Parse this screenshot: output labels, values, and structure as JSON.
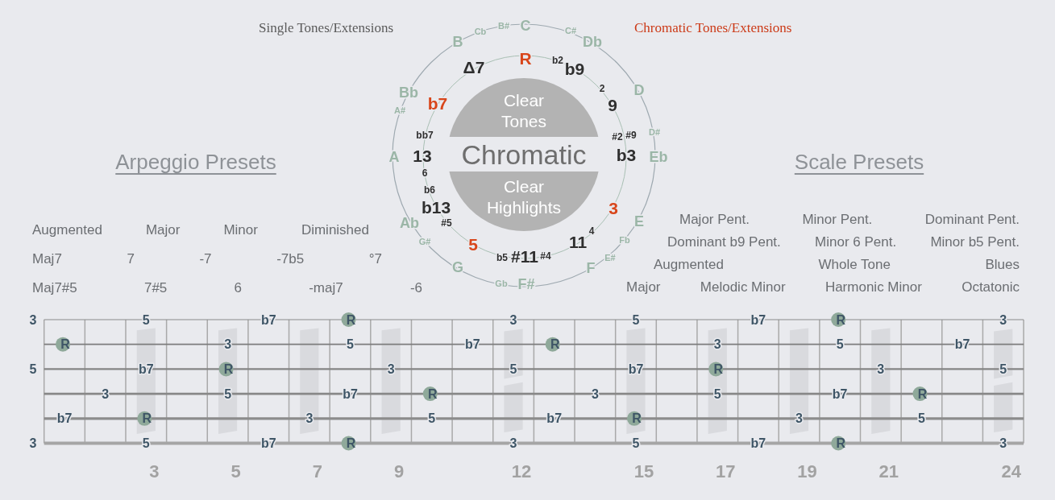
{
  "mode_toggle": [
    {
      "label": "Single Tones/Extensions",
      "selected": false
    },
    {
      "label": "Chromatic Tones/Extensions",
      "selected": true
    }
  ],
  "circle": {
    "notes": [
      {
        "label": "Cb",
        "kind": "secondary"
      },
      {
        "label": "B#",
        "kind": "secondary"
      },
      {
        "label": "C",
        "kind": "primary"
      },
      {
        "label": "C#",
        "kind": "secondary"
      },
      {
        "label": "B",
        "kind": "primary"
      },
      {
        "label": "Db",
        "kind": "primary"
      },
      {
        "label": "Bb",
        "kind": "primary"
      },
      {
        "label": "D",
        "kind": "primary"
      },
      {
        "label": "A#",
        "kind": "secondary"
      },
      {
        "label": "D#",
        "kind": "secondary"
      },
      {
        "label": "A",
        "kind": "primary"
      },
      {
        "label": "Eb",
        "kind": "primary"
      },
      {
        "label": "Ab",
        "kind": "primary"
      },
      {
        "label": "E",
        "kind": "primary"
      },
      {
        "label": "G#",
        "kind": "secondary"
      },
      {
        "label": "Fb",
        "kind": "secondary"
      },
      {
        "label": "E#",
        "kind": "secondary"
      },
      {
        "label": "G",
        "kind": "primary"
      },
      {
        "label": "F",
        "kind": "primary"
      },
      {
        "label": "Gb",
        "kind": "secondary"
      },
      {
        "label": "F#",
        "kind": "primary"
      }
    ],
    "intervals": [
      {
        "label": "Δ7",
        "kind": "primary",
        "selected": false
      },
      {
        "label": "R",
        "kind": "primary",
        "selected": true
      },
      {
        "label": "b2",
        "kind": "secondary",
        "selected": false
      },
      {
        "label": "b9",
        "kind": "primary",
        "selected": false
      },
      {
        "label": "2",
        "kind": "secondary",
        "selected": false
      },
      {
        "label": "b7",
        "kind": "primary",
        "selected": true
      },
      {
        "label": "9",
        "kind": "primary",
        "selected": false
      },
      {
        "label": "bb7",
        "kind": "secondary",
        "selected": false
      },
      {
        "label": "#2",
        "kind": "secondary",
        "selected": false
      },
      {
        "label": "#9",
        "kind": "secondary",
        "selected": false
      },
      {
        "label": "13",
        "kind": "primary",
        "selected": false
      },
      {
        "label": "b3",
        "kind": "primary",
        "selected": false
      },
      {
        "label": "6",
        "kind": "secondary",
        "selected": false
      },
      {
        "label": "b6",
        "kind": "secondary",
        "selected": false
      },
      {
        "label": "b13",
        "kind": "primary",
        "selected": false
      },
      {
        "label": "3",
        "kind": "primary",
        "selected": true
      },
      {
        "label": "#5",
        "kind": "secondary",
        "selected": false
      },
      {
        "label": "5",
        "kind": "primary",
        "selected": true
      },
      {
        "label": "11",
        "kind": "primary",
        "selected": false
      },
      {
        "label": "4",
        "kind": "secondary",
        "selected": false
      },
      {
        "label": "b5",
        "kind": "secondary",
        "selected": false
      },
      {
        "label": "#11",
        "kind": "primary",
        "selected": false
      },
      {
        "label": "#4",
        "kind": "secondary",
        "selected": false
      }
    ],
    "clear_tones_button": "Clear Tones",
    "mode_label": "Chromatic",
    "clear_highlights_button": "Clear Highlights"
  },
  "arpeggio_presets": {
    "title": "Arpeggio Presets",
    "options": [
      "Augmented",
      "Major",
      "Minor",
      "Diminished",
      "Maj7",
      "7",
      "-7",
      "-7b5",
      "°7",
      "Maj7#5",
      "7#5",
      "6",
      "-maj7",
      "-6"
    ]
  },
  "scale_presets": {
    "title": "Scale Presets",
    "options": [
      "Major Pent.",
      "Minor Pent.",
      "Dominant Pent.",
      "Dominant b9 Pent.",
      "Minor 6 Pent.",
      "Minor b5 Pent.",
      "Augmented",
      "Whole Tone",
      "Blues",
      "Major",
      "Melodic Minor",
      "Harmonic Minor",
      "Octatonic"
    ]
  },
  "fretboard": {
    "strings": [
      {
        "notes": [
          {
            "label": "3",
            "root": false
          },
          {
            "label": "5",
            "root": false
          },
          {
            "label": "b7",
            "root": false
          },
          {
            "label": "R",
            "root": true
          },
          {
            "label": "3",
            "root": false
          },
          {
            "label": "5",
            "root": false
          },
          {
            "label": "b7",
            "root": false
          },
          {
            "label": "R",
            "root": true
          },
          {
            "label": "3",
            "root": false
          }
        ]
      },
      {
        "notes": [
          {
            "label": "R",
            "root": true
          },
          {
            "label": "3",
            "root": false
          },
          {
            "label": "5",
            "root": false
          },
          {
            "label": "b7",
            "root": false
          },
          {
            "label": "R",
            "root": true
          },
          {
            "label": "3",
            "root": false
          },
          {
            "label": "5",
            "root": false
          },
          {
            "label": "b7",
            "root": false
          }
        ]
      },
      {
        "notes": [
          {
            "label": "5",
            "root": false
          },
          {
            "label": "b7",
            "root": false
          },
          {
            "label": "R",
            "root": true
          },
          {
            "label": "3",
            "root": false
          },
          {
            "label": "5",
            "root": false
          },
          {
            "label": "b7",
            "root": false
          },
          {
            "label": "R",
            "root": true
          },
          {
            "label": "3",
            "root": false
          },
          {
            "label": "5",
            "root": false
          }
        ]
      },
      {
        "notes": [
          {
            "label": "3",
            "root": false
          },
          {
            "label": "5",
            "root": false
          },
          {
            "label": "b7",
            "root": false
          },
          {
            "label": "R",
            "root": true
          },
          {
            "label": "3",
            "root": false
          },
          {
            "label": "5",
            "root": false
          },
          {
            "label": "b7",
            "root": false
          },
          {
            "label": "R",
            "root": true
          }
        ]
      },
      {
        "notes": [
          {
            "label": "b7",
            "root": false
          },
          {
            "label": "R",
            "root": true
          },
          {
            "label": "3",
            "root": false
          },
          {
            "label": "5",
            "root": false
          },
          {
            "label": "b7",
            "root": false
          },
          {
            "label": "R",
            "root": true
          },
          {
            "label": "3",
            "root": false
          },
          {
            "label": "5",
            "root": false
          }
        ]
      },
      {
        "notes": [
          {
            "label": "3",
            "root": false
          },
          {
            "label": "5",
            "root": false
          },
          {
            "label": "b7",
            "root": false
          },
          {
            "label": "R",
            "root": true
          },
          {
            "label": "3",
            "root": false
          },
          {
            "label": "5",
            "root": false
          },
          {
            "label": "b7",
            "root": false
          },
          {
            "label": "R",
            "root": true
          },
          {
            "label": "3",
            "root": false
          }
        ]
      }
    ],
    "fret_markers": [
      {
        "label": "3",
        "double": false
      },
      {
        "label": "5",
        "double": false
      },
      {
        "label": "7",
        "double": false
      },
      {
        "label": "9",
        "double": false
      },
      {
        "label": "12",
        "double": true
      },
      {
        "label": "15",
        "double": false
      },
      {
        "label": "17",
        "double": false
      },
      {
        "label": "19",
        "double": false
      },
      {
        "label": "21",
        "double": false
      },
      {
        "label": "24",
        "double": true
      }
    ]
  }
}
